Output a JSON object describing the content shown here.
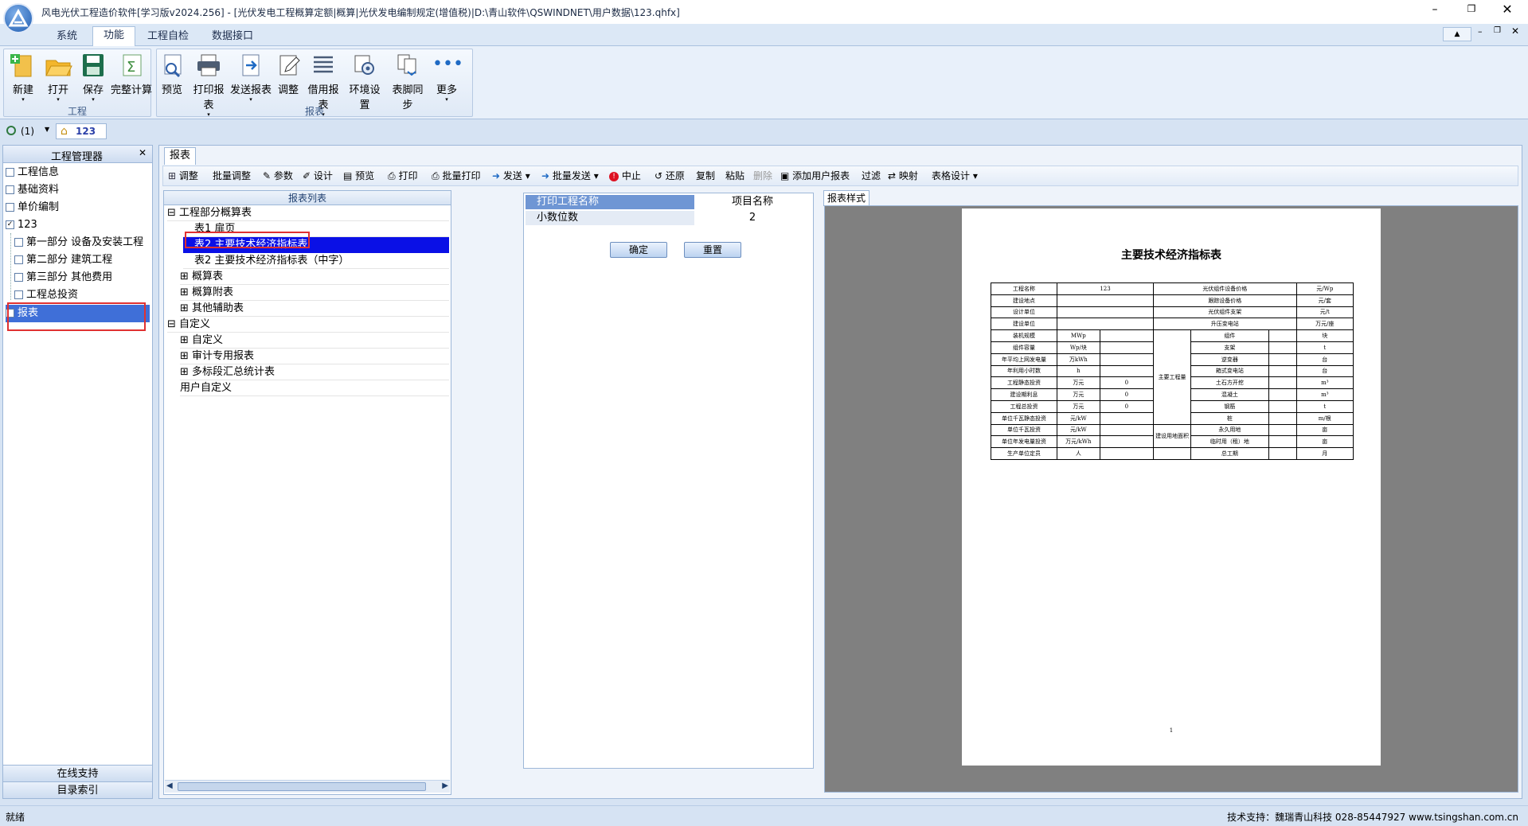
{
  "window": {
    "title": "风电光伏工程造价软件[学习版v2024.256] - [光伏发电工程概算定额|概算|光伏发电编制规定(增值税)|D:\\青山软件\\QSWINDNET\\用户数据\\123.qhfx]"
  },
  "menu_tabs": [
    "系统",
    "功能",
    "工程自检",
    "数据接口"
  ],
  "ribbon": {
    "group1": {
      "title": "工程",
      "buttons": [
        "新建",
        "打开",
        "保存",
        "完整计算"
      ]
    },
    "group2": {
      "title": "报表",
      "buttons": [
        "预览",
        "打印报表",
        "发送报表",
        "调整",
        "借用报表",
        "环境设置",
        "表脚同步",
        "更多"
      ]
    }
  },
  "pager": {
    "count_label": "(1)",
    "project_tab": "123"
  },
  "manager": {
    "title": "工程管理器",
    "items": [
      "工程信息",
      "基础资料",
      "单价编制",
      "123",
      "第一部分 设备及安装工程",
      "第二部分 建筑工程",
      "第三部分 其他费用",
      "工程总投资",
      "报表"
    ],
    "footer": [
      "在线支持",
      "目录索引"
    ]
  },
  "doc_tab": "报表",
  "toolbar": [
    "调整",
    "批量调整",
    "参数",
    "设计",
    "预览",
    "打印",
    "批量打印",
    "发送",
    "批量发送",
    "中止",
    "还原",
    "复制",
    "粘贴",
    "删除",
    "添加用户报表",
    "过滤",
    "映射",
    "表格设计"
  ],
  "report_list": {
    "header": "报表列表",
    "items": [
      "工程部分概算表",
      "表1 扉页",
      "表2 主要技术经济指标表",
      "表2 主要技术经济指标表（中字）",
      "概算表",
      "概算附表",
      "其他辅助表",
      "自定义",
      "自定义",
      "审计专用报表",
      "多标段汇总统计表",
      "用户自定义"
    ]
  },
  "params": {
    "header_left": "打印工程名称",
    "header_right": "项目名称",
    "row_label": "小数位数",
    "row_value": "2",
    "ok_button": "确定",
    "reset_button": "重置"
  },
  "preview": {
    "tab": "报表样式",
    "report_title": "主要技术经济指标表",
    "page_no": "1",
    "table": {
      "top_rows": [
        [
          "工程名称",
          "123",
          "光伏组件设备价格",
          "元/Wp"
        ],
        [
          "建设地点",
          "",
          "跟踪设备价格",
          "元/套"
        ],
        [
          "设计单位",
          "",
          "光伏组件支架",
          "元/t"
        ],
        [
          "建设单位",
          "",
          "升压变电站",
          "万元/座"
        ]
      ],
      "left_rows": [
        [
          "装机规模",
          "MWp",
          ""
        ],
        [
          "组件容量",
          "Wp/块",
          ""
        ],
        [
          "年平均上网发电量",
          "万kWh",
          ""
        ],
        [
          "年利用小时数",
          "h",
          ""
        ],
        [
          "工程静态投资",
          "万元",
          "0"
        ],
        [
          "建设期利息",
          "万元",
          "0"
        ],
        [
          "工程总投资",
          "万元",
          "0"
        ],
        [
          "单位千瓦静态投资",
          "元/kW",
          ""
        ],
        [
          "单位千瓦投资",
          "元/kW",
          ""
        ],
        [
          "单位年发电量投资",
          "万元/kWh",
          ""
        ],
        [
          "生产单位定员",
          "人",
          ""
        ]
      ],
      "qty_label": "主要工程量",
      "land_label": "建设用地面积",
      "right_rows": [
        [
          "组件",
          "块"
        ],
        [
          "支架",
          "t"
        ],
        [
          "逆变器",
          "台"
        ],
        [
          "箱式变电站",
          "台"
        ],
        [
          "土石方开挖",
          "m³"
        ],
        [
          "混凝土",
          "m³"
        ],
        [
          "钢筋",
          "t"
        ],
        [
          "桩",
          "m/根"
        ],
        [
          "永久用地",
          "亩"
        ],
        [
          "临时用（租）地",
          "亩"
        ],
        [
          "总工期",
          "月"
        ]
      ]
    }
  },
  "status": {
    "left": "就绪",
    "right": "技术支持：魏瑞青山科技 028-85447927 www.tsingshan.com.cn"
  }
}
